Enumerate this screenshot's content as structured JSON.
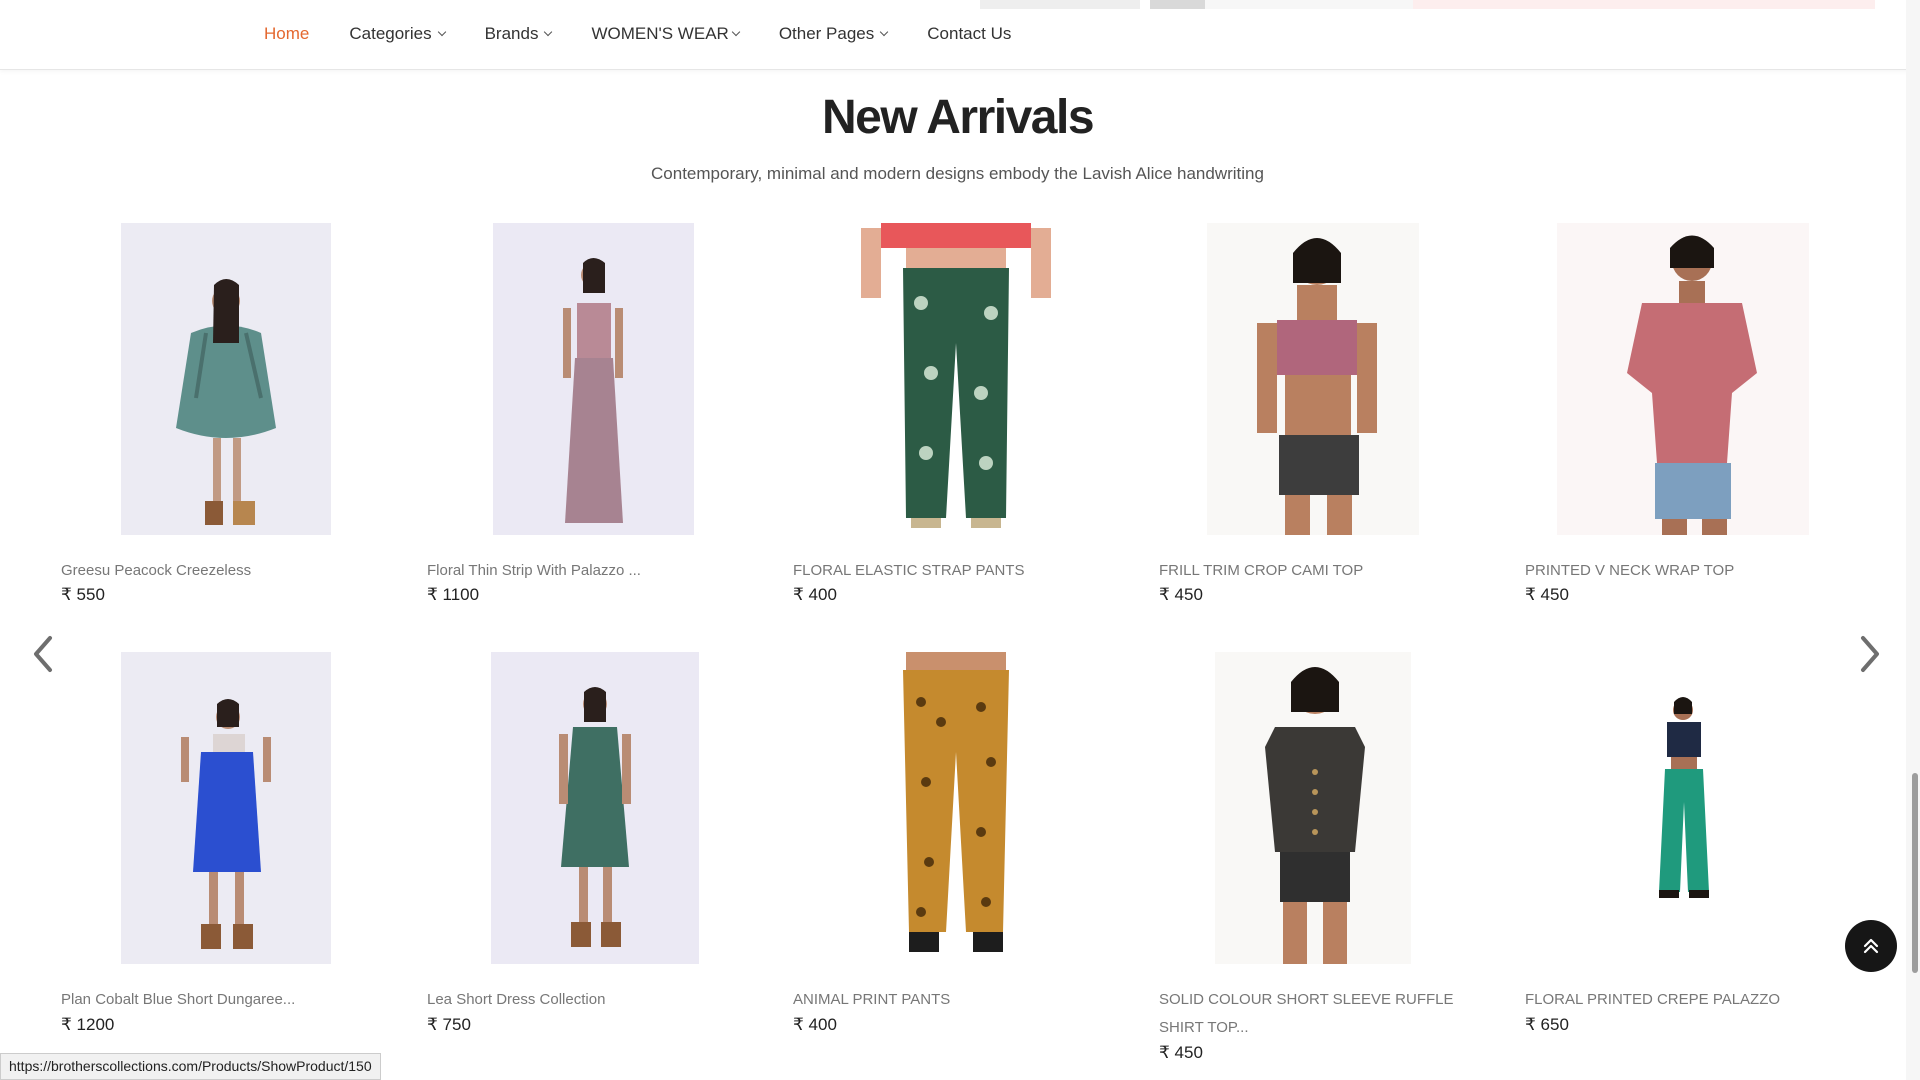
{
  "nav": {
    "items": [
      {
        "label": "Home",
        "active": true,
        "dropdown": false
      },
      {
        "label": "Categories",
        "active": false,
        "dropdown": true
      },
      {
        "label": "Brands",
        "active": false,
        "dropdown": true
      },
      {
        "label": "WOMEN'S WEAR",
        "active": false,
        "dropdown": true
      },
      {
        "label": "Other Pages",
        "active": false,
        "dropdown": true
      },
      {
        "label": "Contact Us",
        "active": false,
        "dropdown": false
      }
    ]
  },
  "section": {
    "title": "New Arrivals",
    "subtitle": "Contemporary, minimal and modern designs embody the Lavish Alice handwriting"
  },
  "products": [
    {
      "name": "Greesu Peacock Creezeless",
      "price": "₹ 550"
    },
    {
      "name": "Floral Thin Strip With Palazzo ...",
      "price": "₹ 1100"
    },
    {
      "name": "FLORAL ELASTIC STRAP PANTS",
      "price": "₹ 400"
    },
    {
      "name": "FRILL TRIM CROP CAMI TOP",
      "price": "₹ 450"
    },
    {
      "name": "PRINTED V NECK WRAP TOP",
      "price": "₹ 450"
    },
    {
      "name": "Plan Cobalt Blue Short Dungaree...",
      "price": "₹ 1200"
    },
    {
      "name": "Lea Short Dress Collection",
      "price": "₹ 750"
    },
    {
      "name": "ANIMAL PRINT PANTS",
      "price": "₹ 400"
    },
    {
      "name": "SOLID COLOUR SHORT SLEEVE RUFFLE SHIRT TOP...",
      "price": "₹ 450"
    },
    {
      "name": "FLORAL PRINTED CREPE PALAZZO",
      "price": "₹ 650"
    }
  ],
  "icons": {
    "prev": "chevron-left-icon",
    "next": "chevron-right-icon",
    "scroll_top": "double-chevron-up-icon"
  },
  "colors": {
    "accent": "#e4682f",
    "text": "#222222",
    "muted": "#777777"
  },
  "status_bar": {
    "url": "https://brotherscollections.com/Products/ShowProduct/150"
  }
}
